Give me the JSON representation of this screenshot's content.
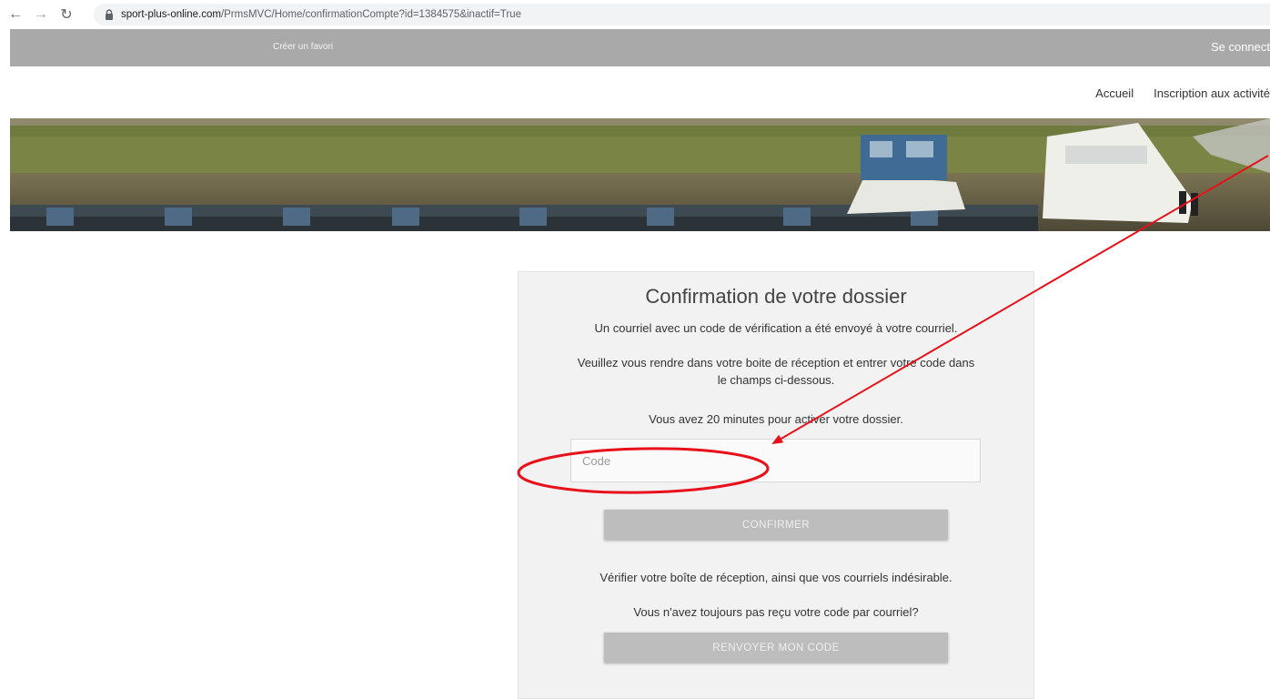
{
  "browser": {
    "back_icon": "arrow-left-icon",
    "forward_icon": "arrow-right-icon",
    "reload_icon": "reload-icon",
    "lock_icon": "lock-icon",
    "url_host": "sport-plus-online.com",
    "url_path": "/PrmsMVC/Home/confirmationCompte?id=1384575&inactif=True"
  },
  "header": {
    "favorite_link": "Créer un favori",
    "login_link": "Se connect"
  },
  "nav": {
    "items": [
      "Accueil",
      "Inscription aux activité"
    ]
  },
  "card": {
    "title": "Confirmation de votre dossier",
    "line1": "Un courriel avec un code de vérification a été envoyé à votre courriel.",
    "line2a": "Veuillez vous rendre dans votre boite de réception et entrer votre code dans",
    "line2b": "le champs ci-dessous.",
    "line3": "Vous avez 20 minutes pour activer votre dossier.",
    "code_placeholder": "Code",
    "code_value": "",
    "confirm_label": "CONFIRMER",
    "spam_note": "Vérifier votre boîte de réception, ainsi que vos courriels indésirable.",
    "no_code_question": "Vous n'avez toujours pas reçu votre code par courriel?",
    "resend_label": "RENVOYER MON CODE"
  },
  "colors": {
    "header_bg": "#a9a9a9",
    "card_bg": "#f2f2f2",
    "button_bg": "#bdbdbd",
    "annotation": "#e8101a"
  }
}
